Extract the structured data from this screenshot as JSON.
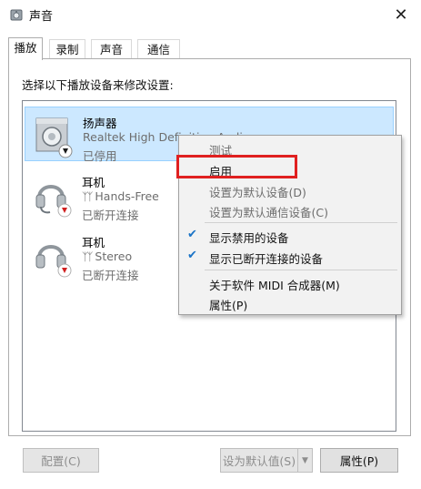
{
  "window": {
    "title": "声音",
    "close_glyph": "✕"
  },
  "tabs": [
    {
      "label": "播放",
      "active": true
    },
    {
      "label": "录制",
      "active": false
    },
    {
      "label": "声音",
      "active": false
    },
    {
      "label": "通信",
      "active": false
    }
  ],
  "instruction": "选择以下播放设备来修改设置:",
  "devices": [
    {
      "name": "扬声器",
      "description": "Realtek High Definition Audio",
      "status": "已停用",
      "icon": "speaker-icon",
      "badge": "disabled-down-arrow-icon",
      "selected": true
    },
    {
      "name": "耳机",
      "description": "Hands-Free",
      "status": "已断开连接",
      "icon": "headset-icon",
      "badge": "disconnected-red-arrow-icon",
      "glyph": "ᛉᛉ",
      "selected": false
    },
    {
      "name": "耳机",
      "description": "Stereo",
      "status": "已断开连接",
      "icon": "headphones-icon",
      "badge": "disconnected-red-arrow-icon",
      "glyph": "ᛉᛉ",
      "selected": false
    }
  ],
  "context_menu": {
    "items": [
      {
        "label": "测试",
        "disabled": true,
        "checked": false
      },
      {
        "label": "启用",
        "disabled": false,
        "checked": false,
        "highlighted": true
      },
      {
        "label": "设置为默认设备(D)",
        "disabled": true,
        "checked": false
      },
      {
        "label": "设置为默认通信设备(C)",
        "disabled": true,
        "checked": false
      },
      {
        "label": "显示禁用的设备",
        "disabled": false,
        "checked": true
      },
      {
        "label": "显示已断开连接的设备",
        "disabled": false,
        "checked": true
      },
      {
        "label": "关于软件 MIDI 合成器(M)",
        "disabled": false,
        "checked": false
      },
      {
        "label": "属性(P)",
        "disabled": false,
        "checked": false
      }
    ],
    "check_glyph": "✔"
  },
  "buttons": {
    "configure": "配置(C)",
    "set_default": "设为默认值(S)",
    "properties": "属性(P)"
  },
  "colors": {
    "selection_bg": "#cce8ff",
    "highlight_border": "#e02020",
    "check": "#1a73c6"
  }
}
